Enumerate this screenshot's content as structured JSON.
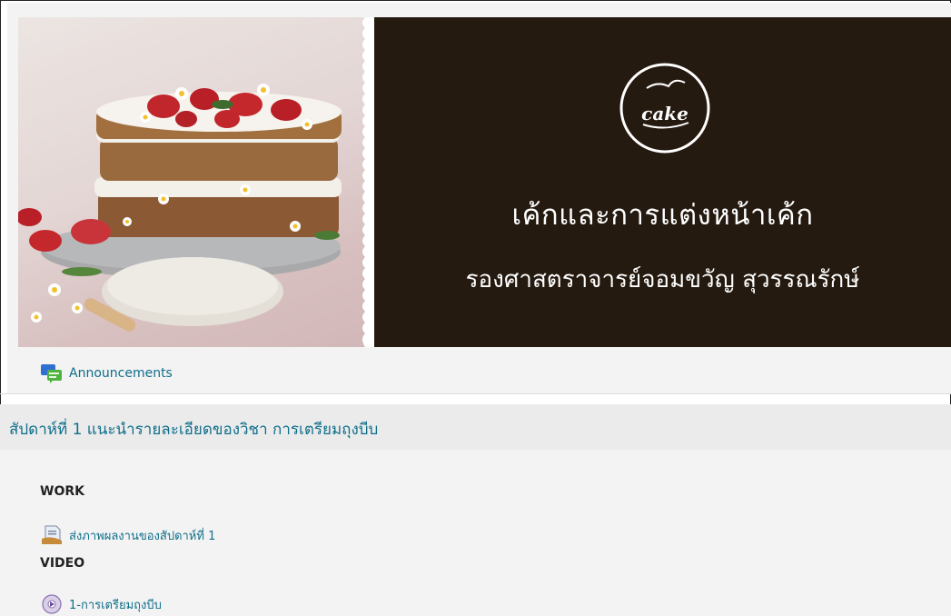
{
  "banner": {
    "title": "เค้กและการแต่งหน้าเค้ก",
    "instructor": "รองศาสตราจารย์จอมขวัญ สุวรรณรักษ์",
    "logo_text": "cake",
    "colors": {
      "dark_panel": "#251a10",
      "link": "#0f6e8a"
    }
  },
  "announcements": {
    "label": "Announcements",
    "icon": "forum-icon"
  },
  "section": {
    "title": "สัปดาห์ที่ 1 แนะนำรายละเอียดของวิชา การเตรียมถุงบีบ",
    "labels": {
      "work": "WORK",
      "video": "VIDEO"
    },
    "activities": [
      {
        "label": "ส่งภาพผลงานของสัปดาห์ที่ 1",
        "icon": "assignment-icon"
      },
      {
        "label": "1-การเตรียมถุงบีบ",
        "icon": "video-icon"
      }
    ]
  }
}
